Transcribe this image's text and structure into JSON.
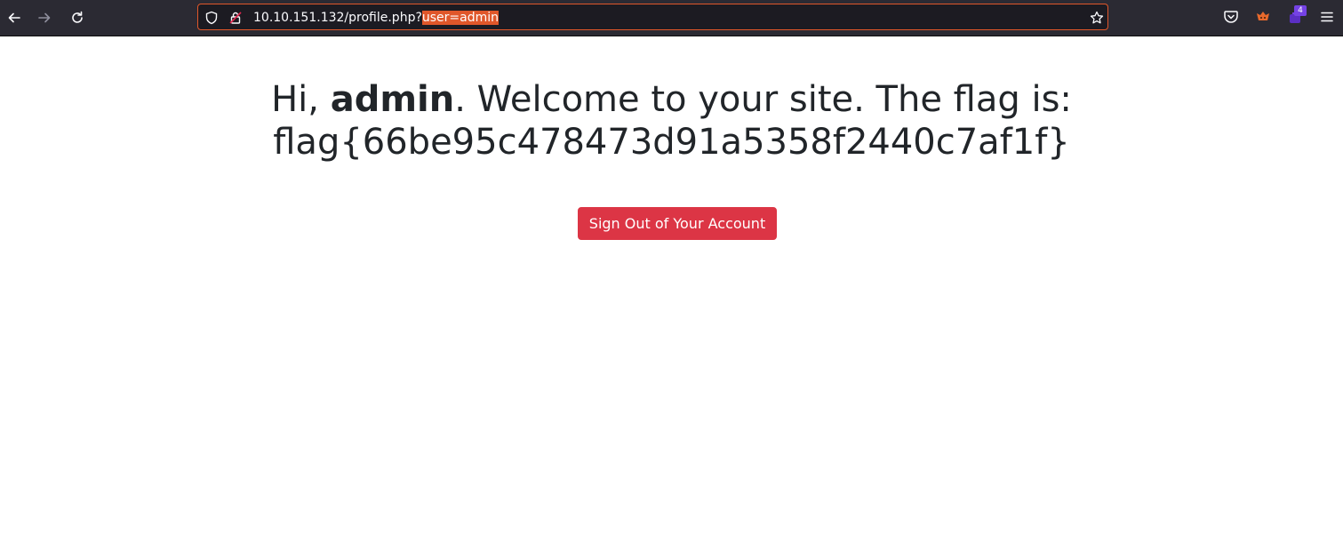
{
  "browser": {
    "url_plain": "10.10.151.132/profile.php?",
    "url_selected": "user=admin",
    "extension_badge": "4",
    "colors": {
      "toolbar": "#2b2a33",
      "urlbar": "#1c1b22",
      "focus_ring": "#e0572a"
    }
  },
  "page": {
    "greeting_prefix": "Hi, ",
    "username": "admin",
    "welcome_suffix": ". Welcome to your site. The flag is:",
    "flag": "flag{66be95c478473d91a5358f2440c7af1f}",
    "signout_label": "Sign Out of Your Account",
    "colors": {
      "text": "#212529",
      "danger": "#dc3545"
    }
  }
}
